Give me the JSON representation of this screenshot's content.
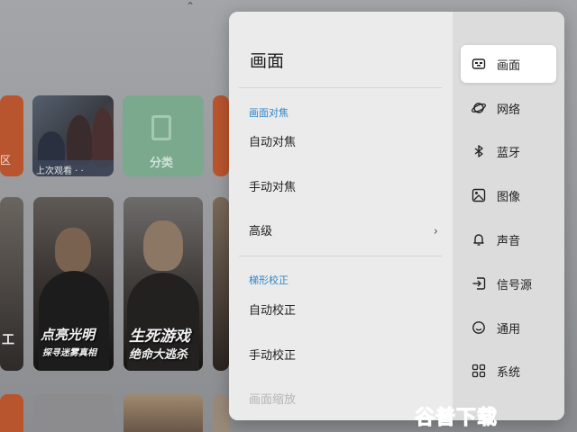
{
  "background": {
    "tiles": {
      "left_label": "区",
      "recent_label": "上次观看 · ·",
      "category_label": "分类"
    },
    "posters": {
      "left_text": "工",
      "poster1_title_line1": "点亮光明",
      "poster1_title_line2": "探寻迷雾真相",
      "poster2_title_line1": "生死游戏",
      "poster2_title_line2": "绝命大逃杀"
    }
  },
  "panel": {
    "title": "画面",
    "sections": [
      {
        "header": "画面对焦",
        "items": [
          "自动对焦",
          "手动对焦",
          "高级"
        ]
      },
      {
        "header": "梯形校正",
        "items": [
          "自动校正",
          "手动校正",
          "画面缩放"
        ]
      }
    ],
    "chevron": "›"
  },
  "nav": {
    "items": [
      {
        "label": "画面",
        "icon": "picture-mode-icon",
        "active": true
      },
      {
        "label": "网络",
        "icon": "planet-network-icon",
        "active": false
      },
      {
        "label": "蓝牙",
        "icon": "bluetooth-icon",
        "active": false
      },
      {
        "label": "图像",
        "icon": "image-icon",
        "active": false
      },
      {
        "label": "声音",
        "icon": "bell-icon",
        "active": false
      },
      {
        "label": "信号源",
        "icon": "signal-source-icon",
        "active": false
      },
      {
        "label": "通用",
        "icon": "face-icon",
        "active": false
      },
      {
        "label": "系统",
        "icon": "grid-icon",
        "active": false
      }
    ]
  },
  "watermark": "谷普下载",
  "colors": {
    "accent": "#2f86c9",
    "panel_bg": "#ebebeb",
    "nav_bg": "#dcdcdc",
    "active_bg": "#ffffff"
  }
}
